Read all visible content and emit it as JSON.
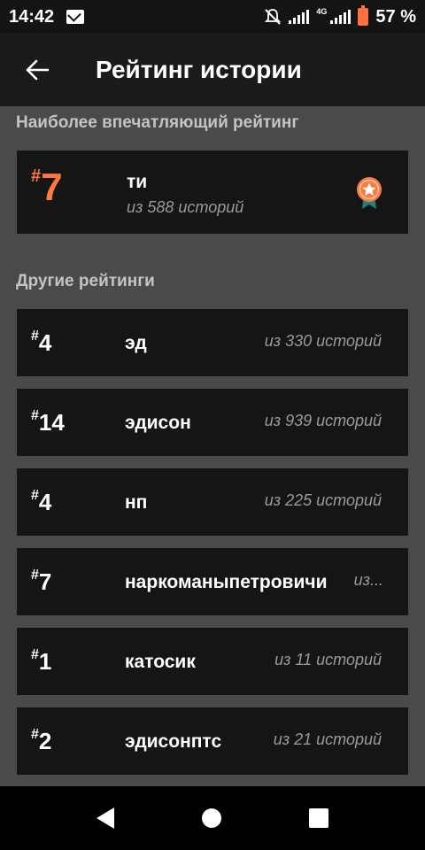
{
  "status": {
    "time": "14:42",
    "network": "4G",
    "battery": "57 %"
  },
  "header": {
    "title": "Рейтинг истории"
  },
  "best": {
    "section_title": "Наиболее впечатляющий рейтинг",
    "hash": "#",
    "rank": "7",
    "name": "ти",
    "sub": "из 588 историй"
  },
  "others": {
    "section_title": "Другие рейтинги",
    "items": [
      {
        "hash": "#",
        "rank": "4",
        "name": "эд",
        "sub": "из 330 историй"
      },
      {
        "hash": "#",
        "rank": "14",
        "name": "эдисон",
        "sub": "из 939 историй"
      },
      {
        "hash": "#",
        "rank": "4",
        "name": "нп",
        "sub": "из 225 историй"
      },
      {
        "hash": "#",
        "rank": "7",
        "name": "наркоманыпетровичи",
        "sub": "из..."
      },
      {
        "hash": "#",
        "rank": "1",
        "name": "катосик",
        "sub": "из 11 историй"
      },
      {
        "hash": "#",
        "rank": "2",
        "name": "эдисонптс",
        "sub": "из 21 историй"
      }
    ]
  },
  "colors": {
    "accent": "#ff7a3d",
    "card": "#151515",
    "background": "#4a4a4a",
    "medal_ribbon": "#1f7f7a"
  }
}
